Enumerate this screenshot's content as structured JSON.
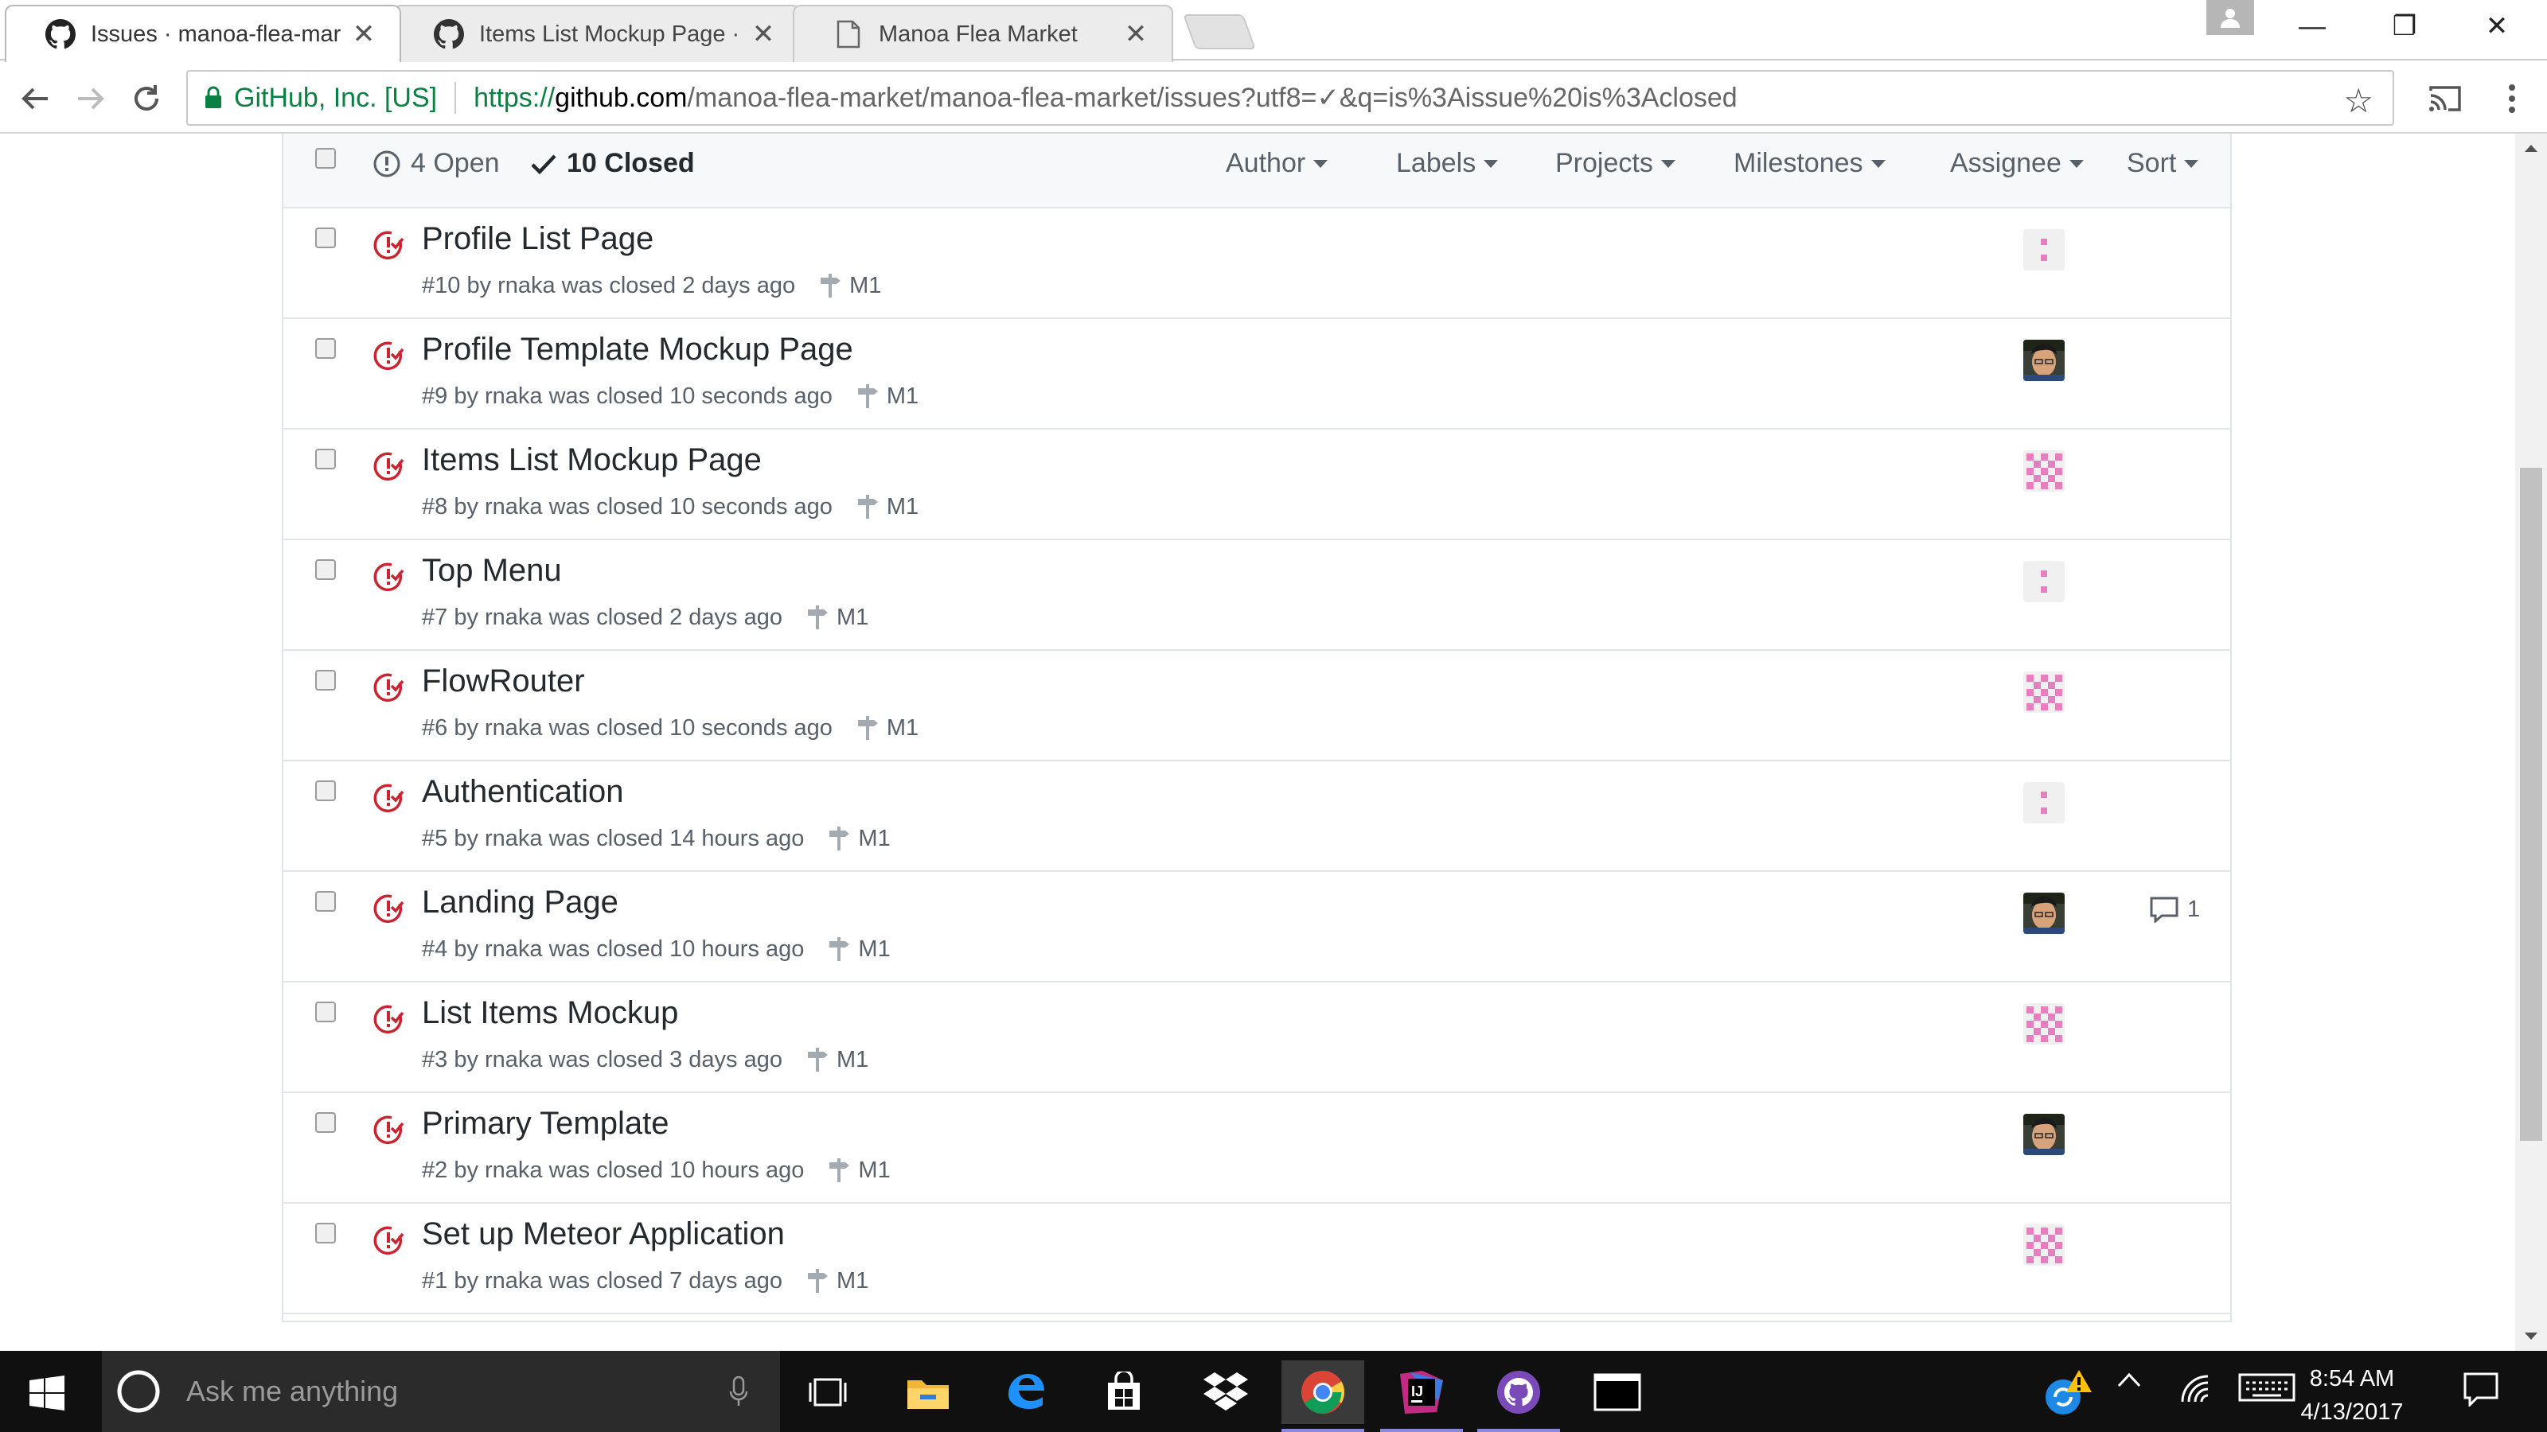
{
  "browser": {
    "tabs": [
      {
        "title": "Issues · manoa-flea-mark",
        "favicon": "github-icon",
        "active": true
      },
      {
        "title": "Items List Mockup Page ·",
        "favicon": "github-icon",
        "active": false
      },
      {
        "title": "Manoa Flea Market",
        "favicon": "page-icon",
        "active": false
      }
    ],
    "close_glyph": "✕",
    "omnibox": {
      "secure_name": "GitHub, Inc. [US]",
      "url_scheme": "https://",
      "url_host": "github.com",
      "url_rest": "/manoa-flea-market/manoa-flea-market/issues?utf8=✓&q=is%3Aissue%20is%3Aclosed"
    },
    "window_controls": {
      "minimize": "—",
      "restore": "❐",
      "close": "✕"
    }
  },
  "issues": {
    "open_label": "4 Open",
    "closed_label": "10 Closed",
    "filters": [
      "Author",
      "Labels",
      "Projects",
      "Milestones",
      "Assignee",
      "Sort"
    ],
    "colors": {
      "closed_icon": "#cb2431",
      "identicon": "#e67fc0",
      "meta_text": "#586069"
    },
    "rows": [
      {
        "title": "Profile List Page",
        "meta": "#10 by rnaka was closed 2 days ago",
        "milestone": "M1",
        "avatar": "identicon-dots",
        "comments": ""
      },
      {
        "title": "Profile Template Mockup Page",
        "meta": "#9 by rnaka was closed 10 seconds ago",
        "milestone": "M1",
        "avatar": "photo",
        "comments": ""
      },
      {
        "title": "Items List Mockup Page",
        "meta": "#8 by rnaka was closed 10 seconds ago",
        "milestone": "M1",
        "avatar": "identicon-grid",
        "comments": ""
      },
      {
        "title": "Top Menu",
        "meta": "#7 by rnaka was closed 2 days ago",
        "milestone": "M1",
        "avatar": "identicon-dots",
        "comments": ""
      },
      {
        "title": "FlowRouter",
        "meta": "#6 by rnaka was closed 10 seconds ago",
        "milestone": "M1",
        "avatar": "identicon-grid",
        "comments": ""
      },
      {
        "title": "Authentication",
        "meta": "#5 by rnaka was closed 14 hours ago",
        "milestone": "M1",
        "avatar": "identicon-dots",
        "comments": ""
      },
      {
        "title": "Landing Page",
        "meta": "#4 by rnaka was closed 10 hours ago",
        "milestone": "M1",
        "avatar": "photo",
        "comments": "1"
      },
      {
        "title": "List Items Mockup",
        "meta": "#3 by rnaka was closed 3 days ago",
        "milestone": "M1",
        "avatar": "identicon-grid",
        "comments": ""
      },
      {
        "title": "Primary Template",
        "meta": "#2 by rnaka was closed 10 hours ago",
        "milestone": "M1",
        "avatar": "photo",
        "comments": ""
      },
      {
        "title": "Set up Meteor Application",
        "meta": "#1 by rnaka was closed 7 days ago",
        "milestone": "M1",
        "avatar": "identicon-grid",
        "comments": ""
      }
    ]
  },
  "taskbar": {
    "search_placeholder": "Ask me anything",
    "apps": [
      "task-view-icon",
      "file-explorer-icon",
      "edge-icon",
      "store-icon",
      "dropbox-icon",
      "chrome-icon",
      "intellij-icon",
      "github-desktop-icon",
      "terminal-icon"
    ],
    "clock_time": "8:54 AM",
    "clock_date": "4/13/2017"
  }
}
